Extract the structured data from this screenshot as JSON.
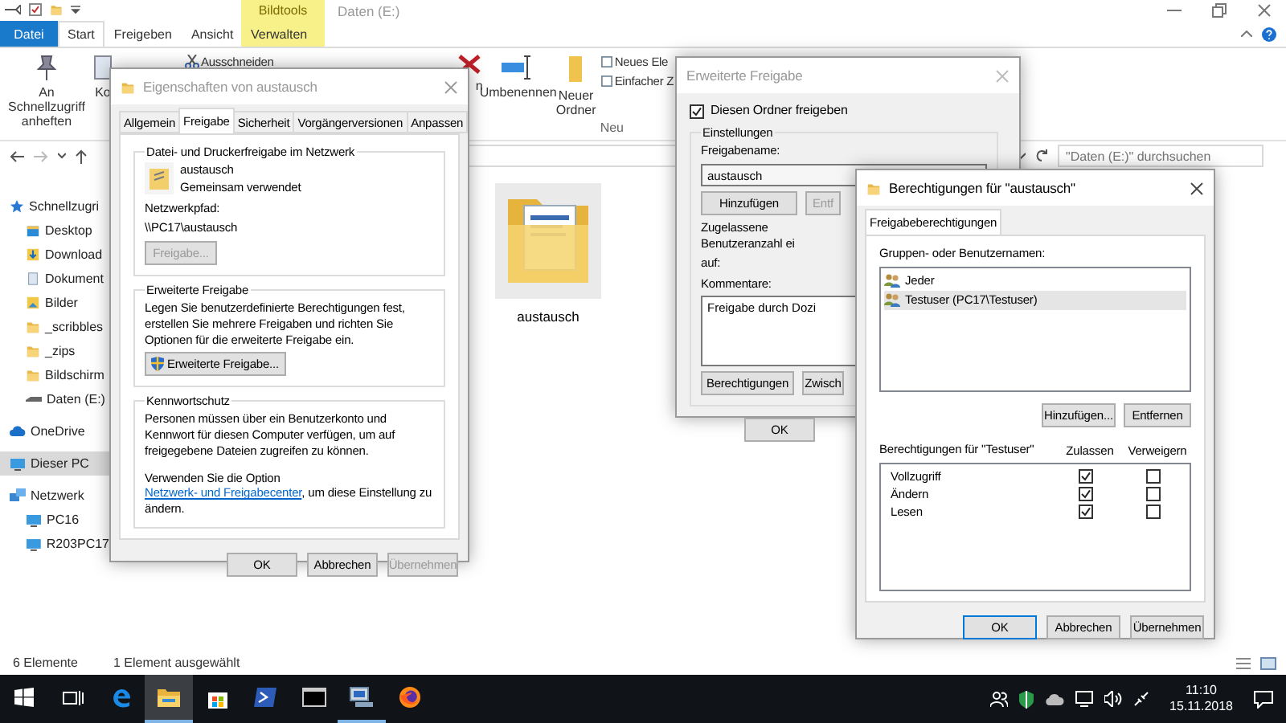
{
  "explorer": {
    "context_header": "Bildtools",
    "title": "Daten (E:)",
    "ribbon_tabs": [
      {
        "label": "Datei",
        "kind": "file",
        "selected": false
      },
      {
        "label": "Start",
        "kind": "tab",
        "selected": true
      },
      {
        "label": "Freigeben",
        "kind": "tab",
        "selected": false
      },
      {
        "label": "Ansicht",
        "kind": "tab",
        "selected": false
      },
      {
        "label": "Verwalten",
        "kind": "context",
        "selected": false
      }
    ],
    "ribbon": {
      "pin": "An Schnellzugriff anheften",
      "copy": "Ko",
      "cut": "Ausschneiden",
      "delete": "n",
      "rename": "Umbenennen",
      "new_folder": "Neuer Ordner",
      "new_item": "Neues Ele",
      "easy_access": "Einfacher Z",
      "group": "Neu"
    },
    "search": {
      "placeholder": "\"Daten (E:)\" durchsuchen"
    },
    "sidebar": [
      {
        "label": "Schnellzugri",
        "kind": "quick",
        "selected": false,
        "children": [
          {
            "label": "Desktop",
            "kind": "desktop",
            "selected": false
          },
          {
            "label": "Download",
            "kind": "downloads",
            "selected": false
          },
          {
            "label": "Dokument",
            "kind": "documents",
            "selected": false
          },
          {
            "label": "Bilder",
            "kind": "pictures",
            "selected": false
          },
          {
            "label": "_scribbles",
            "kind": "folder",
            "selected": false
          },
          {
            "label": "_zips",
            "kind": "folder",
            "selected": false
          },
          {
            "label": "Bildschirm",
            "kind": "folder",
            "selected": false
          },
          {
            "label": "Daten (E:)",
            "kind": "drive",
            "selected": false
          }
        ]
      },
      {
        "label": "OneDrive",
        "kind": "cloud",
        "selected": false
      },
      {
        "label": "Dieser PC",
        "kind": "pc",
        "selected": true
      },
      {
        "label": "Netzwerk",
        "kind": "network",
        "selected": false,
        "children": [
          {
            "label": "PC16",
            "kind": "pc",
            "selected": false
          },
          {
            "label": "R203PC17",
            "kind": "pc",
            "selected": false
          }
        ]
      }
    ],
    "files": [
      {
        "name": "austausch"
      }
    ],
    "status_bar": {
      "count": "6 Elemente",
      "selection": "1 Element ausgewählt"
    }
  },
  "properties_dialog": {
    "title": "Eigenschaften von austausch",
    "tabs": [
      {
        "label": "Allgemein",
        "selected": false
      },
      {
        "label": "Freigabe",
        "selected": true
      },
      {
        "label": "Sicherheit",
        "selected": false
      },
      {
        "label": "Vorgängerversionen",
        "selected": false
      },
      {
        "label": "Anpassen",
        "selected": false
      }
    ],
    "network_share": {
      "legend": "Datei- und Druckerfreigabe im Netzwerk",
      "name": "austausch",
      "status": "Gemeinsam verwendet",
      "path_label": "Netzwerkpfad:",
      "path": "\\\\PC17\\austausch",
      "button": {
        "label": "Freigabe...",
        "disabled": true
      }
    },
    "advanced": {
      "legend": "Erweiterte Freigabe",
      "text": "Legen Sie benutzerdefinierte Berechtigungen fest, erstellen Sie mehrere Freigaben und richten Sie Optionen für die erweiterte Freigabe ein.",
      "button": "Erweiterte Freigabe..."
    },
    "password": {
      "legend": "Kennwortschutz",
      "text": "Personen müssen über ein Benutzerkonto und Kennwort für diesen Computer verfügen, um auf freigegebene Dateien zugreifen zu können.",
      "note_before": "Verwenden Sie die Option ",
      "link": "Netzwerk- und Freigabecenter",
      "note_after": ", um diese Einstellung zu ändern."
    },
    "buttons": [
      {
        "label": "OK",
        "disabled": false
      },
      {
        "label": "Abbrechen",
        "disabled": false
      },
      {
        "label": "Übernehmen",
        "disabled": true
      }
    ]
  },
  "advanced_dialog": {
    "title": "Erweiterte Freigabe",
    "share": {
      "label": "Diesen Ordner freigeben",
      "checked": true
    },
    "legend": "Einstellungen",
    "share_name_label": "Freigabename:",
    "share_name": "austausch",
    "name_buttons": [
      "Hinzufügen",
      "Entf"
    ],
    "limit_label": "Zugelassene Benutzeranzahl ei",
    "limit_label_2": "auf:",
    "comments_label": "Kommentare:",
    "comments": "Freigabe durch Dozi",
    "buttons": [
      "Berechtigungen",
      "Zwisch"
    ],
    "ok": "OK"
  },
  "permissions_dialog": {
    "title": "Berechtigungen für \"austausch\"",
    "tab": "Freigabeberechtigungen",
    "groups_label": "Gruppen- oder Benutzernamen:",
    "users": [
      {
        "name": "Jeder",
        "selected": false
      },
      {
        "name": "Testuser (PC17\\Testuser)",
        "selected": true
      }
    ],
    "add": "Hinzufügen...",
    "remove": "Entfernen",
    "perm_label": "Berechtigungen für \"Testuser\"",
    "allow_header": "Zulassen",
    "deny_header": "Verweigern",
    "permissions": [
      {
        "name": "Vollzugriff",
        "allow": true,
        "deny": false
      },
      {
        "name": "Ändern",
        "allow": true,
        "deny": false
      },
      {
        "name": "Lesen",
        "allow": true,
        "deny": false
      }
    ],
    "buttons": [
      {
        "label": "OK",
        "kind": "default"
      },
      {
        "label": "Abbrechen",
        "kind": "normal"
      },
      {
        "label": "Übernehmen",
        "kind": "normal"
      }
    ]
  },
  "taskbar": {
    "apps": [
      {
        "kind": "start",
        "selected": false,
        "running": false
      },
      {
        "kind": "taskview",
        "selected": false,
        "running": false
      },
      {
        "kind": "edge",
        "selected": false,
        "running": false
      },
      {
        "kind": "explorer",
        "selected": true,
        "running": true
      },
      {
        "kind": "store",
        "selected": false,
        "running": false
      },
      {
        "kind": "powershell",
        "selected": false,
        "running": false
      },
      {
        "kind": "cmd",
        "selected": false,
        "running": false
      },
      {
        "kind": "netapp",
        "selected": false,
        "running": true
      },
      {
        "kind": "firefox",
        "selected": false,
        "running": false
      }
    ],
    "time": "11:10",
    "date": "15.11.2018"
  }
}
